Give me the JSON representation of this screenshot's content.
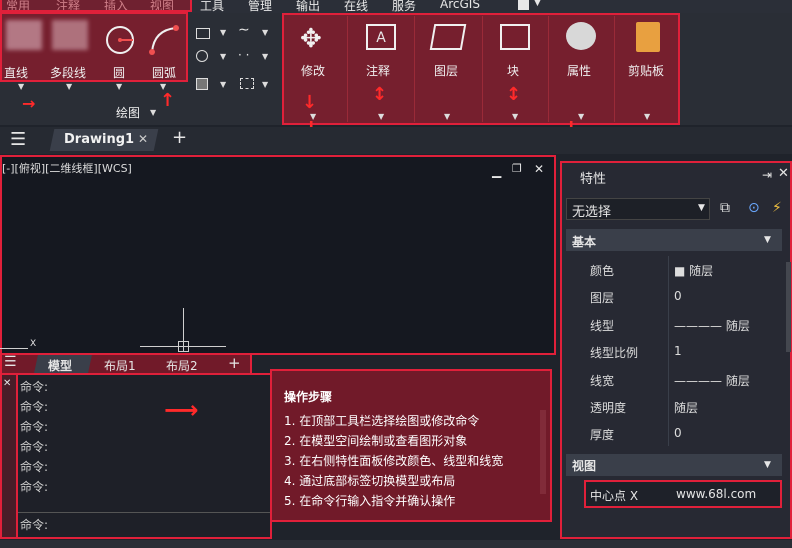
{
  "menu": {
    "items": [
      "常用",
      "注释",
      "插入",
      "视图",
      "工具",
      "管理",
      "输出",
      "在线",
      "服务",
      "ArcGIS"
    ]
  },
  "draw_panel": {
    "tools": [
      "直线",
      "多段线",
      "圆",
      "圆弧"
    ],
    "panel_label": "绘图"
  },
  "modify_panels": [
    "修改",
    "注释",
    "图层",
    "块",
    "属性",
    "剪贴板"
  ],
  "tabs": {
    "menu_icon": "hamburger-icon",
    "active": "Drawing1",
    "close": "✕",
    "add": "+"
  },
  "viewport": {
    "label": "[-][俯视][二维线框][WCS]",
    "axis_x": "X"
  },
  "layout_tabs": [
    "模型",
    "布局1",
    "布局2",
    "+"
  ],
  "command": {
    "lines": [
      "命令:",
      "命令:",
      "命令:",
      "命令:",
      "命令:",
      "命令:",
      "命令:"
    ],
    "input_prompt": "命令:"
  },
  "properties": {
    "title": "特性",
    "selection": "无选择",
    "basic_section": "基本",
    "rows": [
      {
        "key": "颜色",
        "value": "■ 随层"
      },
      {
        "key": "图层",
        "value": "0"
      },
      {
        "key": "线型",
        "value": "———— 随层"
      },
      {
        "key": "线型比例",
        "value": "1"
      },
      {
        "key": "线宽",
        "value": "———— 随层"
      },
      {
        "key": "透明度",
        "value": "随层"
      },
      {
        "key": "厚度",
        "value": "0"
      }
    ],
    "view_section": "视图",
    "center_key": "中心点 X",
    "center_value": "www.68l.com"
  },
  "steps": {
    "title": "操作步骤",
    "items": [
      "1. 在顶部工具栏选择绘图或修改命令",
      "2. 在模型空间绘制或查看图形对象",
      "3. 在右侧特性面板修改颜色、线型和线宽",
      "4. 通过底部标签切换模型或布局",
      "5. 在命令行输入指令并确认操作"
    ]
  },
  "colors": {
    "highlight": "#e0203a",
    "background": "#1f232b"
  }
}
